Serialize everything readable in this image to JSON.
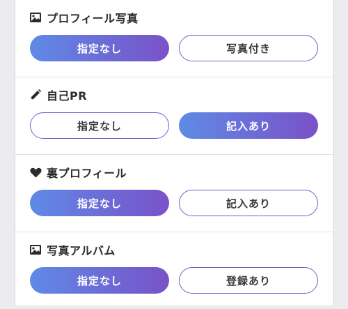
{
  "sections": [
    {
      "title": "プロフィール写真",
      "icon": "image-icon",
      "options": [
        "指定なし",
        "写真付き"
      ],
      "selected_index": 0
    },
    {
      "title": "自己PR",
      "icon": "pencil-icon",
      "options": [
        "指定なし",
        "記入あり"
      ],
      "selected_index": 1
    },
    {
      "title": "裏プロフィール",
      "icon": "heart-icon",
      "options": [
        "指定なし",
        "記入あり"
      ],
      "selected_index": 0
    },
    {
      "title": "写真アルバム",
      "icon": "image-icon",
      "options": [
        "指定なし",
        "登録あり"
      ],
      "selected_index": 0
    }
  ],
  "colors": {
    "accent_start": "#5f8ae6",
    "accent_end": "#7a52c8",
    "outline": "#6f60c8"
  }
}
